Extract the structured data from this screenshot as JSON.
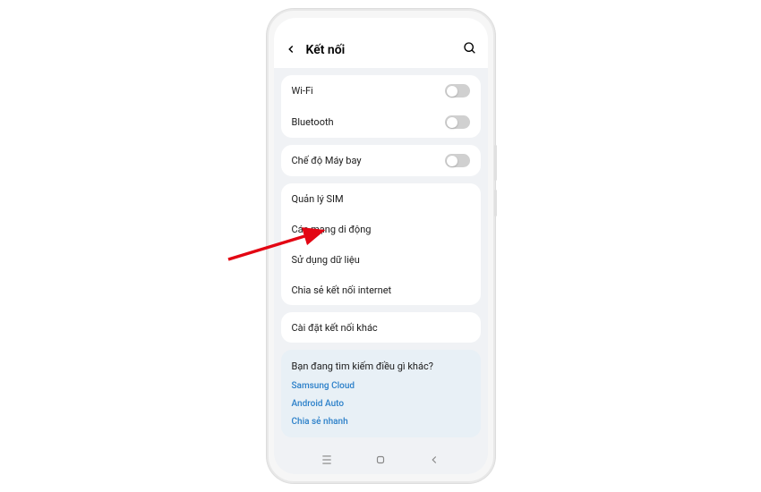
{
  "header": {
    "title": "Kết nối"
  },
  "groups": {
    "g1": {
      "wifi": "Wi-Fi",
      "bluetooth": "Bluetooth"
    },
    "g2": {
      "airplane": "Chế độ Máy bay"
    },
    "g3": {
      "sim": "Quản lý SIM",
      "mobile_net": "Các mạng di động",
      "data_usage": "Sử dụng dữ liệu",
      "hotspot": "Chia sẻ kết nối internet"
    },
    "g4": {
      "more": "Cài đặt kết nối khác"
    }
  },
  "footer": {
    "title": "Bạn đang tìm kiếm điều gì khác?",
    "links": {
      "cloud": "Samsung Cloud",
      "auto": "Android Auto",
      "quickshare": "Chia sẻ nhanh"
    }
  }
}
